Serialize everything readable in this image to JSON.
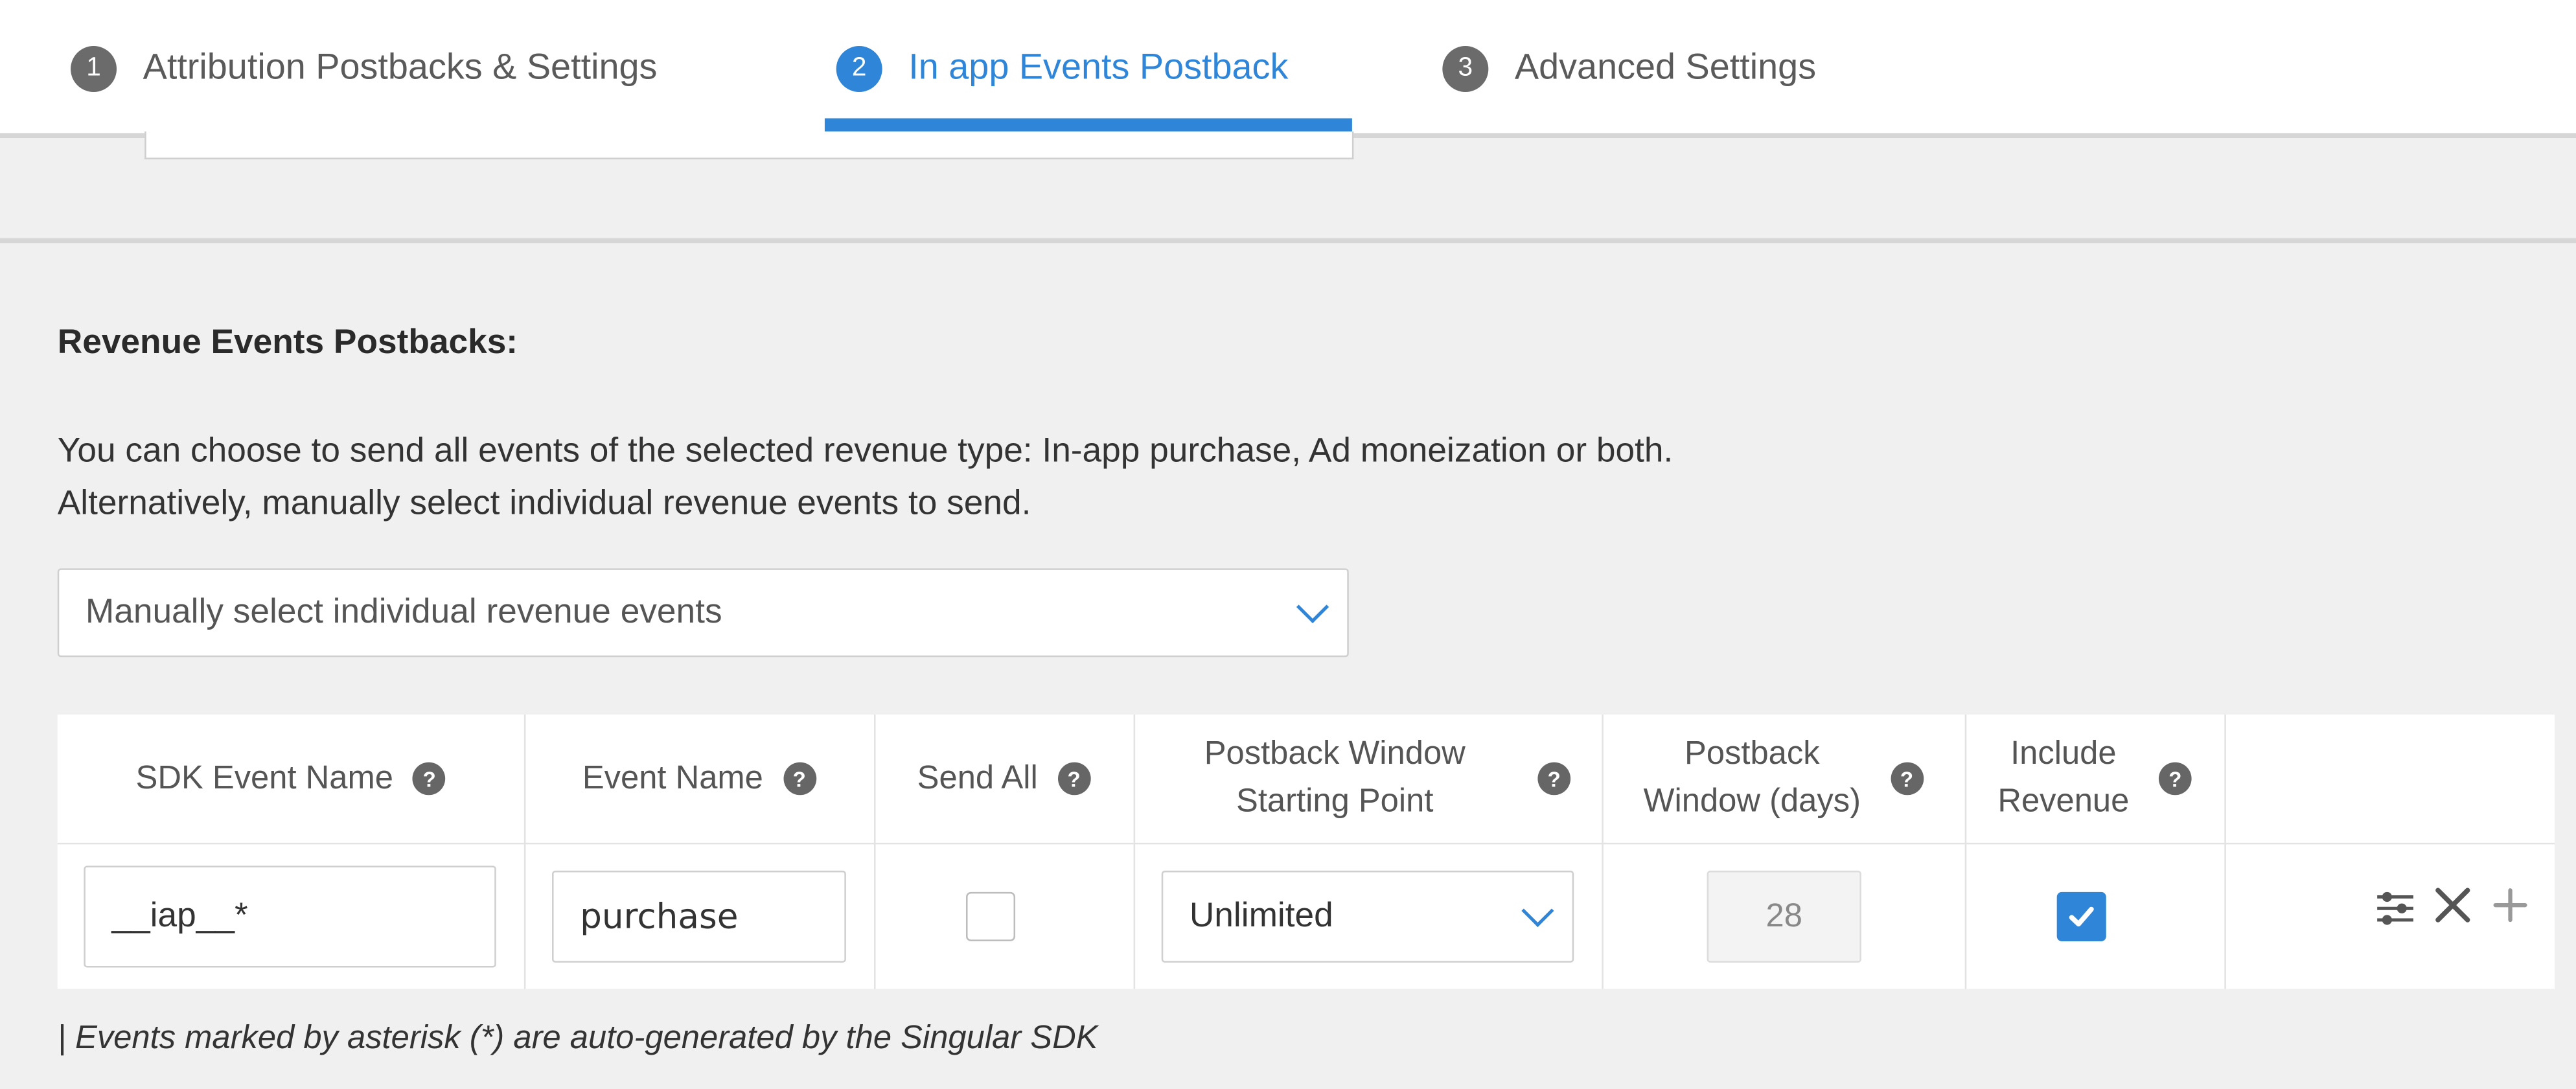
{
  "tabs": [
    {
      "num": "1",
      "label": "Attribution Postbacks & Settings",
      "active": false
    },
    {
      "num": "2",
      "label": "In app Events Postback",
      "active": true
    },
    {
      "num": "3",
      "label": "Advanced Settings",
      "active": false
    }
  ],
  "section": {
    "title": "Revenue Events Postbacks:",
    "desc_line1": "You can choose to send all events of the selected revenue type: In-app purchase, Ad moneization or both.",
    "desc_line2": "Alternatively, manually select individual revenue events to send.",
    "revenue_select": "Manually select individual revenue events"
  },
  "table": {
    "headers": {
      "sdk_event": "SDK Event Name",
      "event_name": "Event Name",
      "send_all": "Send All",
      "pw_start_1": "Postback Window",
      "pw_start_2": "Starting Point",
      "pw_days_1": "Postback",
      "pw_days_2": "Window (days)",
      "inc_rev_1": "Include",
      "inc_rev_2": "Revenue",
      "help": "?"
    },
    "row": {
      "sdk_event": "__iap__*",
      "event_name": "purchase",
      "send_all_checked": false,
      "pw_start": "Unlimited",
      "pw_days": "28",
      "include_revenue_checked": true
    }
  },
  "actions": {
    "settings": "⚙",
    "remove": "✕",
    "add": "+"
  },
  "footnote": "| Events marked by asterisk (*) are auto-generated by the Singular SDK",
  "colors": {
    "accent": "#2f86d9"
  }
}
